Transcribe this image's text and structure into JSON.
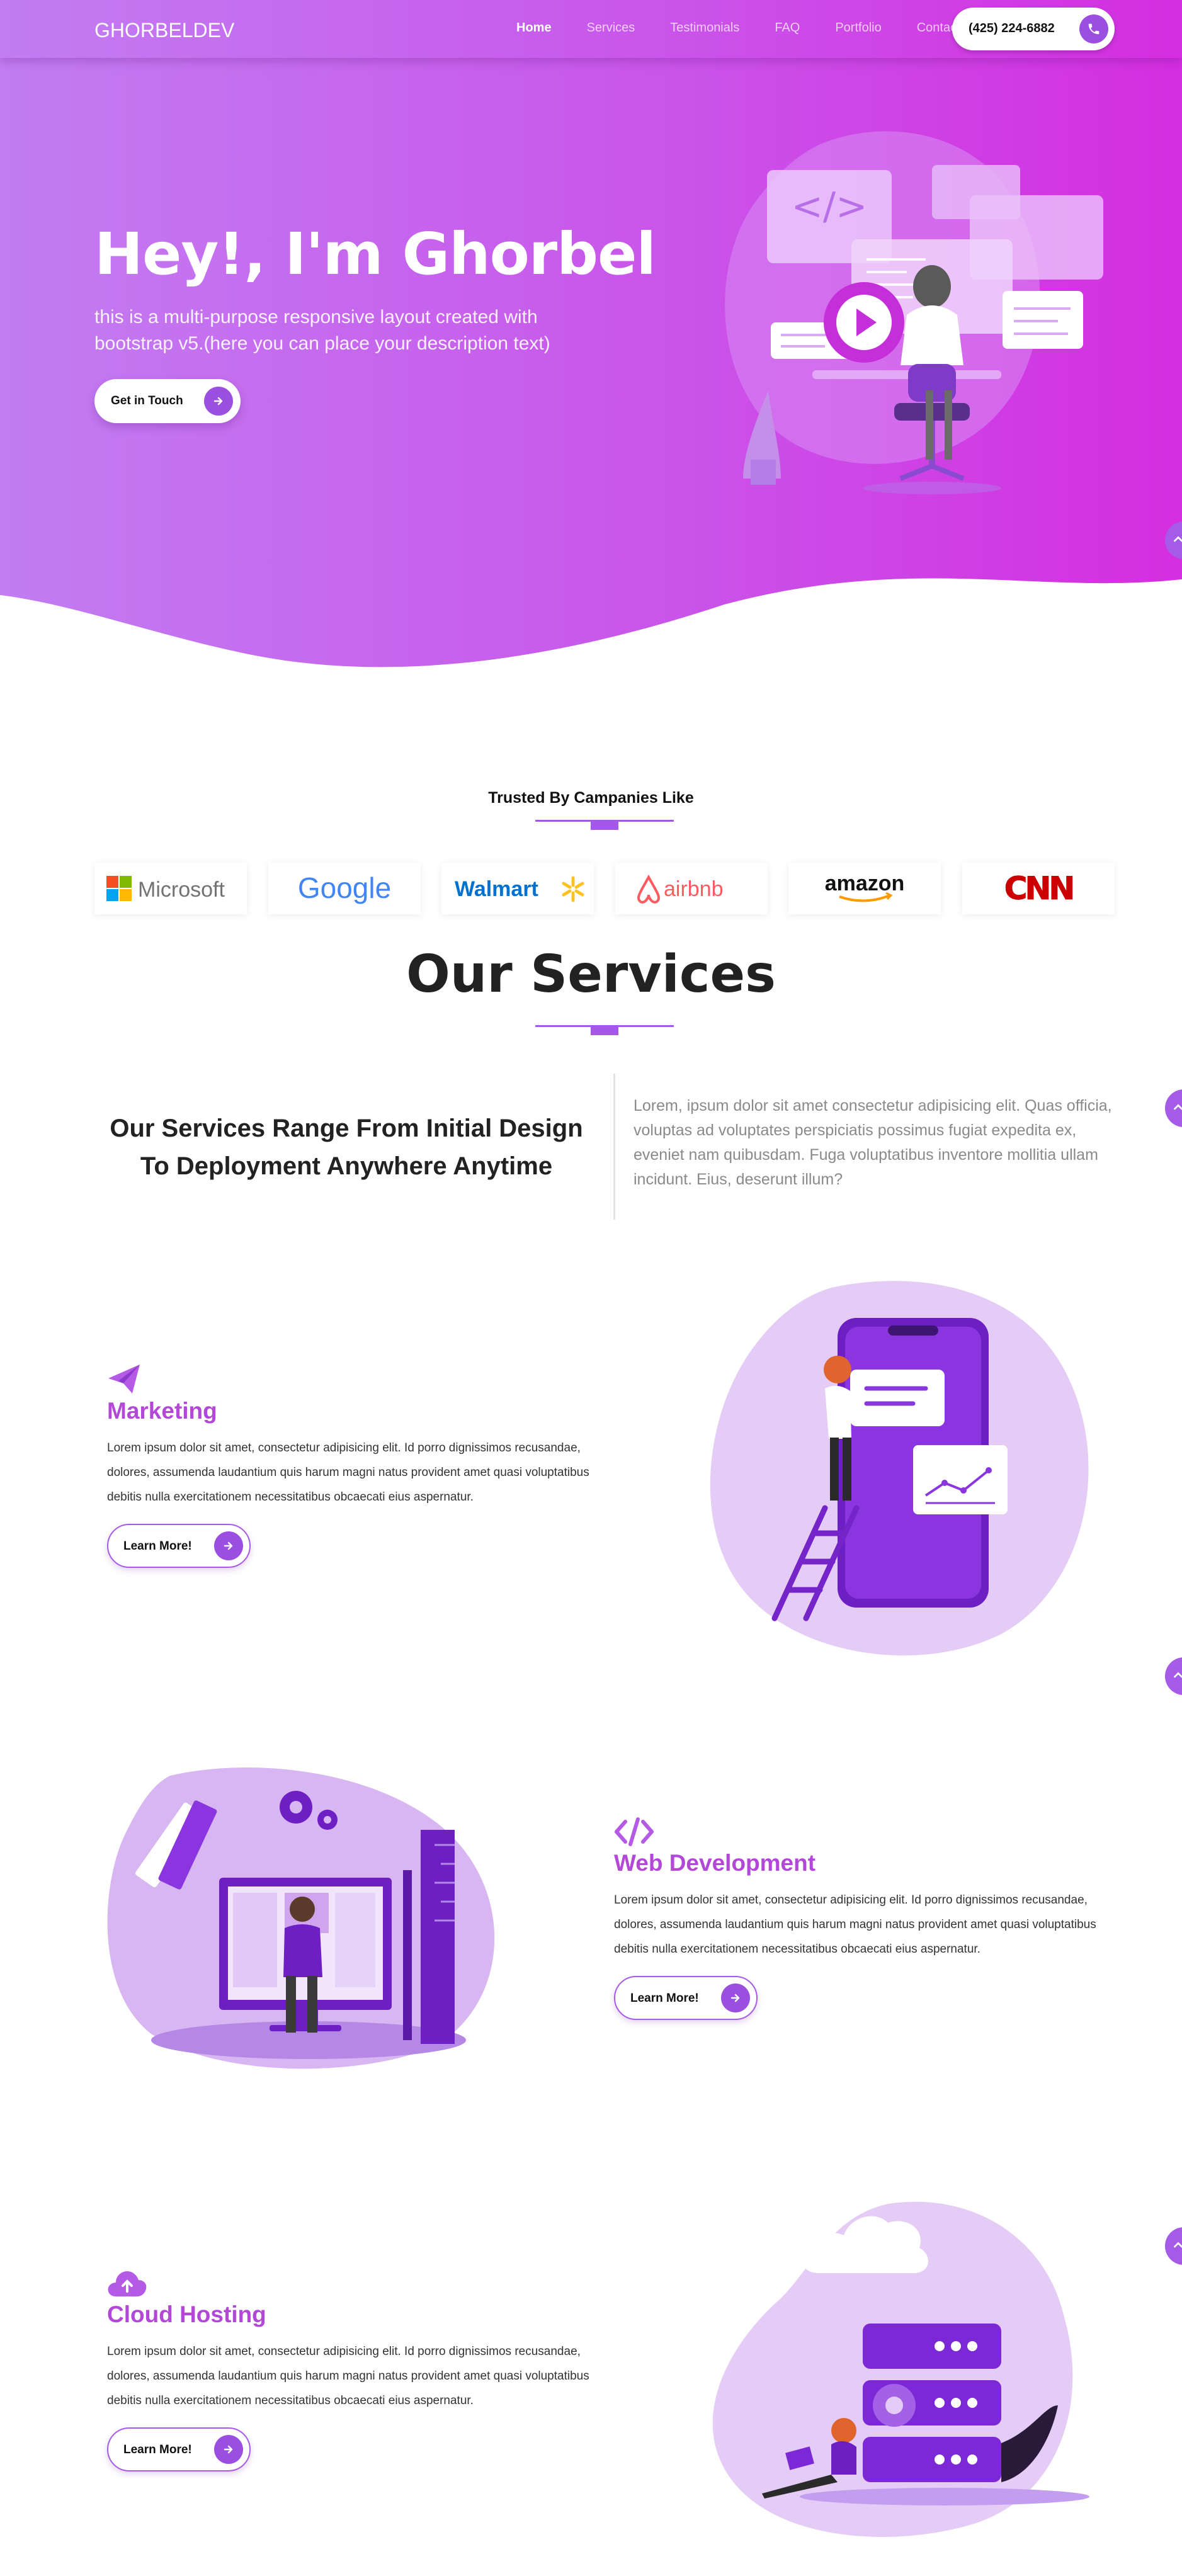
{
  "nav": {
    "brand": "GHORBELDEV",
    "links": [
      "Home",
      "Services",
      "Testimonials",
      "FAQ",
      "Portfolio",
      "Contact"
    ],
    "active": "Home",
    "phone": "(425) 224-6882",
    "phone_icon": "phone-icon"
  },
  "hero": {
    "title": "Hey!, I'm Ghorbel",
    "subtitle": "this is a multi-purpose responsive layout created with bootstrap v5.(here you can place your description text)",
    "cta": "Get in Touch",
    "cta_icon": "arrow-right-icon"
  },
  "trusted": {
    "heading": "Trusted By Campanies Like",
    "logos": [
      "Microsoft",
      "Google",
      "Walmart",
      "airbnb",
      "amazon",
      "CNN"
    ]
  },
  "services": {
    "title": "Our Services",
    "tagline": "Our Services Range From Initial Design To Deployment Anywhere Anytime",
    "intro": "Lorem, ipsum dolor sit amet consectetur adipisicing elit. Quas officia, voluptas ad voluptates perspiciatis possimus fugiat expedita ex, eveniet nam quibusdam. Fuga voluptatibus inventore mollitia ullam incidunt. Eius, deserunt illum?",
    "items": [
      {
        "name": "Marketing",
        "icon": "paper-plane-icon",
        "description": "Lorem ipsum dolor sit amet, consectetur adipisicing elit. Id porro dignissimos recusandae, dolores, assumenda laudantium quis harum magni natus provident amet quasi voluptatibus debitis nulla exercitationem necessitatibus obcaecati eius aspernatur.",
        "button": "Learn More!"
      },
      {
        "name": "Web Development",
        "icon": "code-icon",
        "description": "Lorem ipsum dolor sit amet, consectetur adipisicing elit. Id porro dignissimos recusandae, dolores, assumenda laudantium quis harum magni natus provident amet quasi voluptatibus debitis nulla exercitationem necessitatibus obcaecati eius aspernatur.",
        "button": "Learn More!"
      },
      {
        "name": "Cloud Hosting",
        "icon": "cloud-upload-icon",
        "description": "Lorem ipsum dolor sit amet, consectetur adipisicing elit. Id porro dignissimos recusandae, dolores, assumenda laudantium quis harum magni natus provident amet quasi voluptatibus debitis nulla exercitationem necessitatibus obcaecati eius aspernatur.",
        "button": "Learn More!"
      }
    ]
  },
  "colors": {
    "accent": "#a55ae8",
    "gradient_start": "#c07ef0",
    "gradient_end": "#d02fe0",
    "service_title": "#b347d8"
  }
}
